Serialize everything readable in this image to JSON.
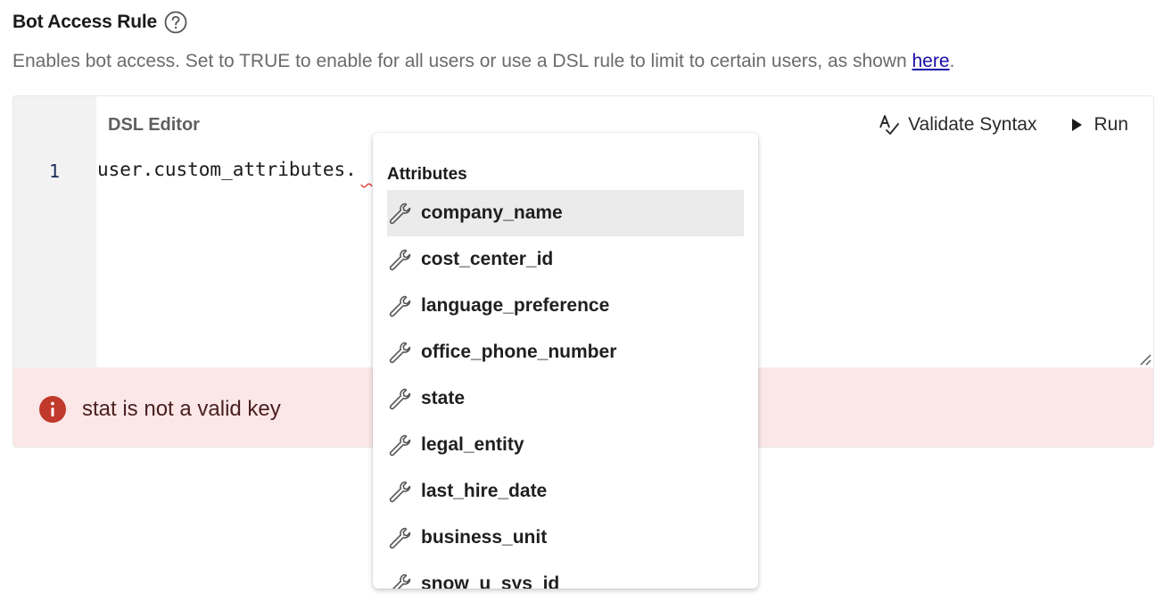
{
  "header": {
    "title": "Bot Access Rule",
    "help_icon": "question-circle-icon"
  },
  "description": {
    "text": "Enables bot access. Set to TRUE to enable for all users or use a DSL rule to limit to certain users, as shown ",
    "link_text": "here",
    "suffix": "."
  },
  "editor": {
    "label": "DSL Editor",
    "line_number": "1",
    "code": "user.custom_attributes.",
    "validate_label": "Validate Syntax",
    "run_label": "Run"
  },
  "error": {
    "message": "stat is not a valid key",
    "color": "#c0392b"
  },
  "autocomplete": {
    "heading": "Attributes",
    "icon": "wrench-icon",
    "items": [
      {
        "label": "company_name",
        "highlighted": true
      },
      {
        "label": "cost_center_id"
      },
      {
        "label": "language_preference"
      },
      {
        "label": "office_phone_number"
      },
      {
        "label": "state"
      },
      {
        "label": "legal_entity"
      },
      {
        "label": "last_hire_date"
      },
      {
        "label": "business_unit"
      },
      {
        "label": "snow_u_sys_id"
      }
    ]
  }
}
